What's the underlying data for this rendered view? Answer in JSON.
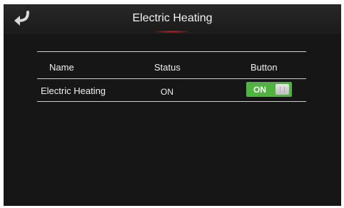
{
  "header": {
    "title": "Electric Heating",
    "back_icon": "back-arrow-icon"
  },
  "table": {
    "columns": [
      "Name",
      "Status",
      "Button"
    ],
    "rows": [
      {
        "name": "Electric Heating",
        "status": "ON",
        "toggle_label": "ON",
        "toggle_on": true
      }
    ]
  },
  "colors": {
    "background": "#161616",
    "text": "#f0f0f0",
    "toggle_on": "#4db53e",
    "title_accent": "#d0202a"
  }
}
